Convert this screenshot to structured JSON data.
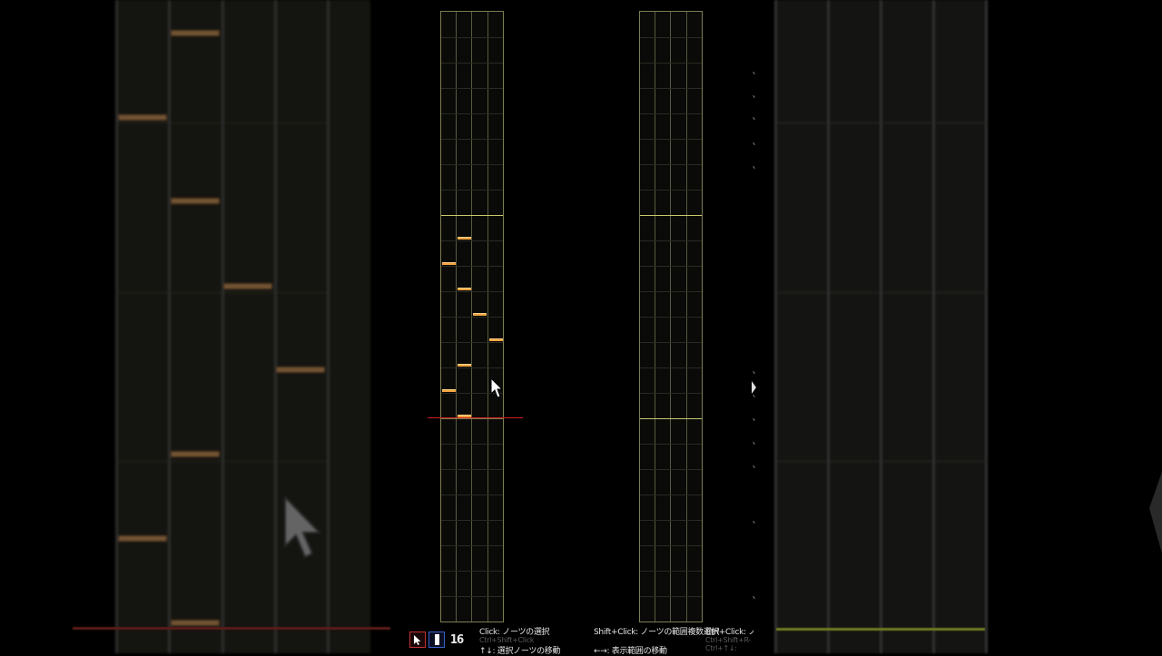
{
  "toolbar": {
    "division_label": "16",
    "hints": {
      "click_select": "Click: ノーツの選択",
      "ctrl_shift_click": "Ctrl+Shift+Click",
      "arrow_move_notes": "↑↓: 選択ノーツの移動",
      "shift_click_range": "Shift+Click: ノーツの範囲複数選択",
      "arrow_move_view": "←→: 表示範囲の移動",
      "ctrl_click": "Ctrl+Click: ノ-",
      "ctrl_shift_r": "Ctrl+Shift+R-",
      "ctrl_arrow": "Ctrl+↑↓:"
    }
  },
  "colors": {
    "note": "#f2a440",
    "measure_line": "#c8c86e",
    "judge_line": "#d02020",
    "tool_select_border": "#c23030",
    "tool_note_border": "#3a5fc8"
  },
  "icons": {
    "tool_select": "arrow-cursor-icon",
    "tool_note": "note-bar-icon",
    "mouse": "mouse-pointer-icon"
  }
}
